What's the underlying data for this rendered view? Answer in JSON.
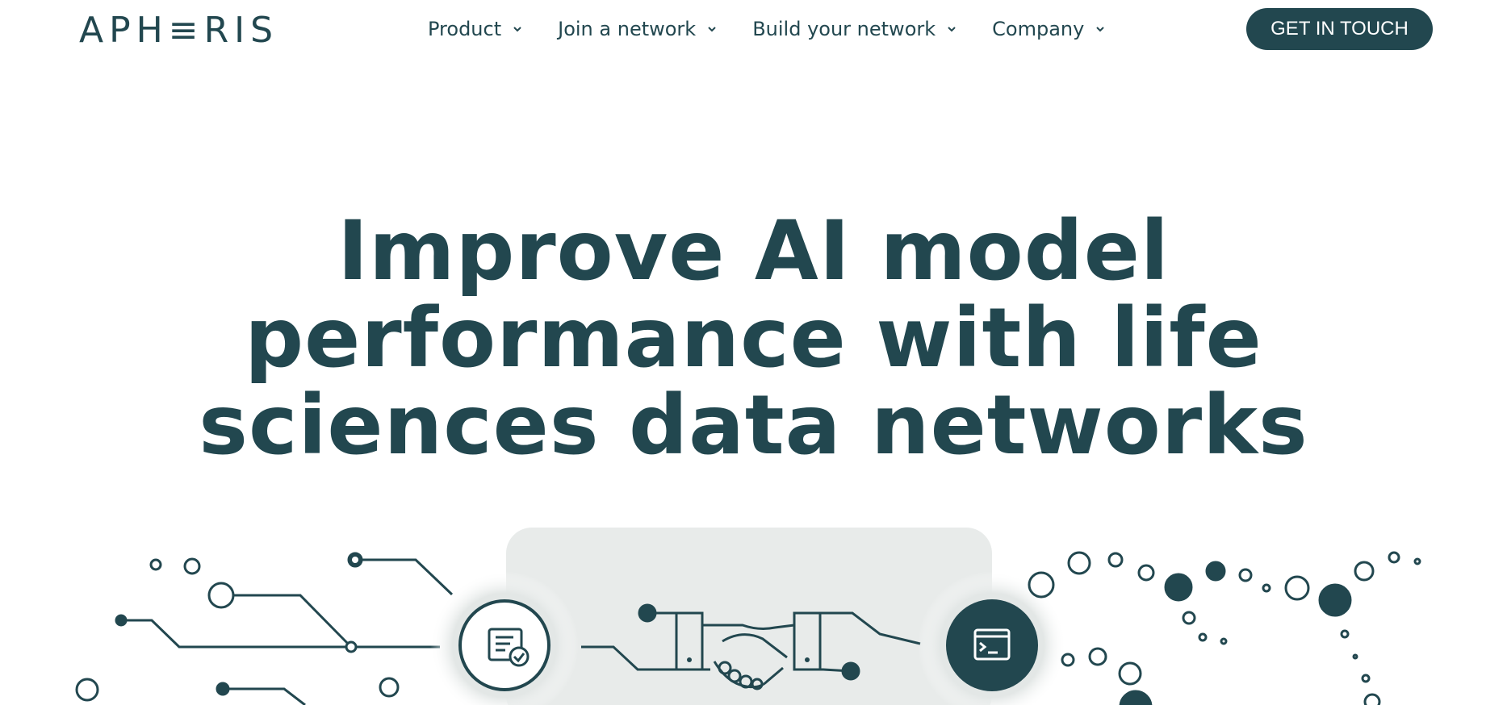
{
  "brand": {
    "logo_text": "APH≡RIS"
  },
  "nav": {
    "items": [
      {
        "label": "Product"
      },
      {
        "label": "Join a network"
      },
      {
        "label": "Build your network"
      },
      {
        "label": "Company"
      }
    ],
    "cta_label": "GET IN TOUCH"
  },
  "hero": {
    "title_lines": [
      "Improve AI model",
      "performance with life",
      "sciences data networks"
    ]
  },
  "icons": [
    "chevron-down-icon",
    "document-check-icon",
    "handshake-icon",
    "terminal-icon"
  ],
  "colors": {
    "brand": "#22474f",
    "background": "#ffffff",
    "panel": "#e8ebea"
  }
}
